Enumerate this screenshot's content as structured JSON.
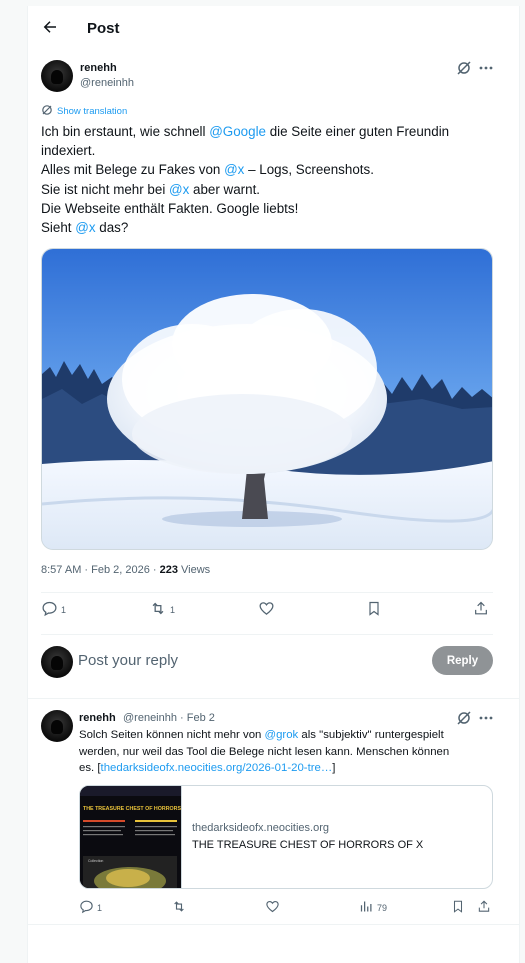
{
  "header": {
    "title": "Post"
  },
  "post": {
    "author": "renehh",
    "handle": "@reneinhh",
    "show_translation": "Show translation",
    "lines": [
      [
        {
          "t": "Ich bin erstaunt, wie schnell "
        },
        {
          "t": "@Google",
          "m": true
        },
        {
          "t": " die Seite einer guten Freundin"
        }
      ],
      [
        {
          "t": "indexiert."
        }
      ],
      [
        {
          "t": "Alles mit Belege zu Fakes von "
        },
        {
          "t": "@x",
          "m": true
        },
        {
          "t": " – Logs, Screenshots."
        }
      ],
      [
        {
          "t": "Sie ist nicht mehr bei "
        },
        {
          "t": "@x",
          "m": true
        },
        {
          "t": " aber warnt."
        }
      ],
      [
        {
          "t": "Die Webseite enthält Fakten. Google liebts!"
        }
      ],
      [
        {
          "t": "Sieht "
        },
        {
          "t": "@x",
          "m": true
        },
        {
          "t": " das?"
        }
      ]
    ],
    "timestamp": "8:57 AM · Feb 2, 2026 · ",
    "views_count": "223",
    "views_label": " Views",
    "replies": "1",
    "reposts": "1"
  },
  "reply_box": {
    "placeholder": "Post your reply",
    "button": "Reply"
  },
  "reply": {
    "author": "renehh",
    "handle_date": "@reneinhh · Feb 2",
    "lines": [
      [
        {
          "t": "Solch Seiten können nicht mehr von "
        },
        {
          "t": "@grok",
          "m": true
        },
        {
          "t": " als \"subjektiv\" runtergespielt"
        }
      ],
      [
        {
          "t": "werden, nur weil das Tool die Belege nicht lesen kann. Menschen können"
        }
      ],
      [
        {
          "t": "es. ["
        },
        {
          "t": "thedarksideofx.neocities.org/2026-01-20-tre…",
          "m": true
        },
        {
          "t": "]"
        }
      ]
    ],
    "card": {
      "domain": "thedarksideofx.neocities.org",
      "title": "THE TREASURE CHEST OF HORRORS OF X",
      "thumb_title": "THE TREASURE CHEST OF HORRORS",
      "thumb_label": "Collection"
    },
    "replies": "1",
    "views": "79"
  },
  "colors": {
    "accent": "#1d9bf0",
    "muted": "#536471",
    "reply_button": "#8f9396"
  }
}
